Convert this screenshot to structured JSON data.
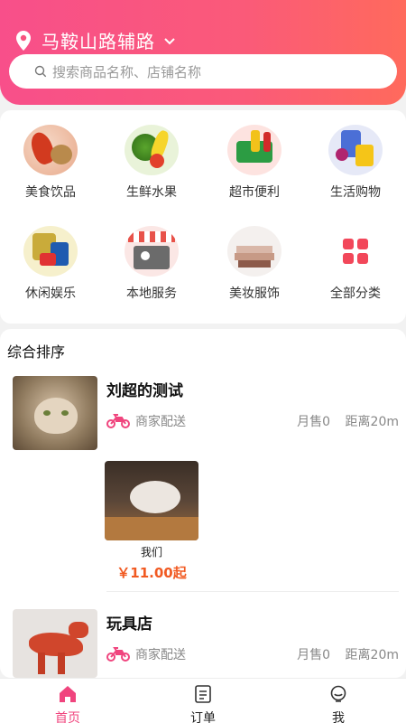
{
  "header": {
    "location": "马鞍山路辅路",
    "location_icon": "map-pin-icon",
    "chevron_icon": "chevron-down-icon"
  },
  "search": {
    "placeholder": "搜索商品名称、店铺名称",
    "icon": "search-icon"
  },
  "categories": [
    {
      "label": "美食饮品",
      "icon": "food-icon"
    },
    {
      "label": "生鲜水果",
      "icon": "fruit-icon"
    },
    {
      "label": "超市便利",
      "icon": "supermarket-icon"
    },
    {
      "label": "生活购物",
      "icon": "shopping-icon"
    },
    {
      "label": "休闲娱乐",
      "icon": "leisure-icon"
    },
    {
      "label": "本地服务",
      "icon": "local-service-icon"
    },
    {
      "label": "美妆服饰",
      "icon": "beauty-icon"
    },
    {
      "label": "全部分类",
      "icon": "grid-icon"
    }
  ],
  "list": {
    "sort_title": "综合排序",
    "shops": [
      {
        "name": "刘超的测试",
        "delivery": "商家配送",
        "sales": "月售0",
        "distance": "距离20m",
        "products": [
          {
            "name": "我们",
            "price": "￥11.00起"
          }
        ]
      },
      {
        "name": "玩具店",
        "delivery": "商家配送",
        "sales": "月售0",
        "distance": "距离20m"
      }
    ]
  },
  "tabbar": [
    {
      "label": "首页",
      "icon": "home-icon",
      "active": true
    },
    {
      "label": "订单",
      "icon": "order-icon",
      "active": false
    },
    {
      "label": "我",
      "icon": "profile-icon",
      "active": false
    }
  ],
  "colors": {
    "brand": "#f84f8a",
    "price": "#f15a22",
    "active_tab": "#f0457e"
  }
}
